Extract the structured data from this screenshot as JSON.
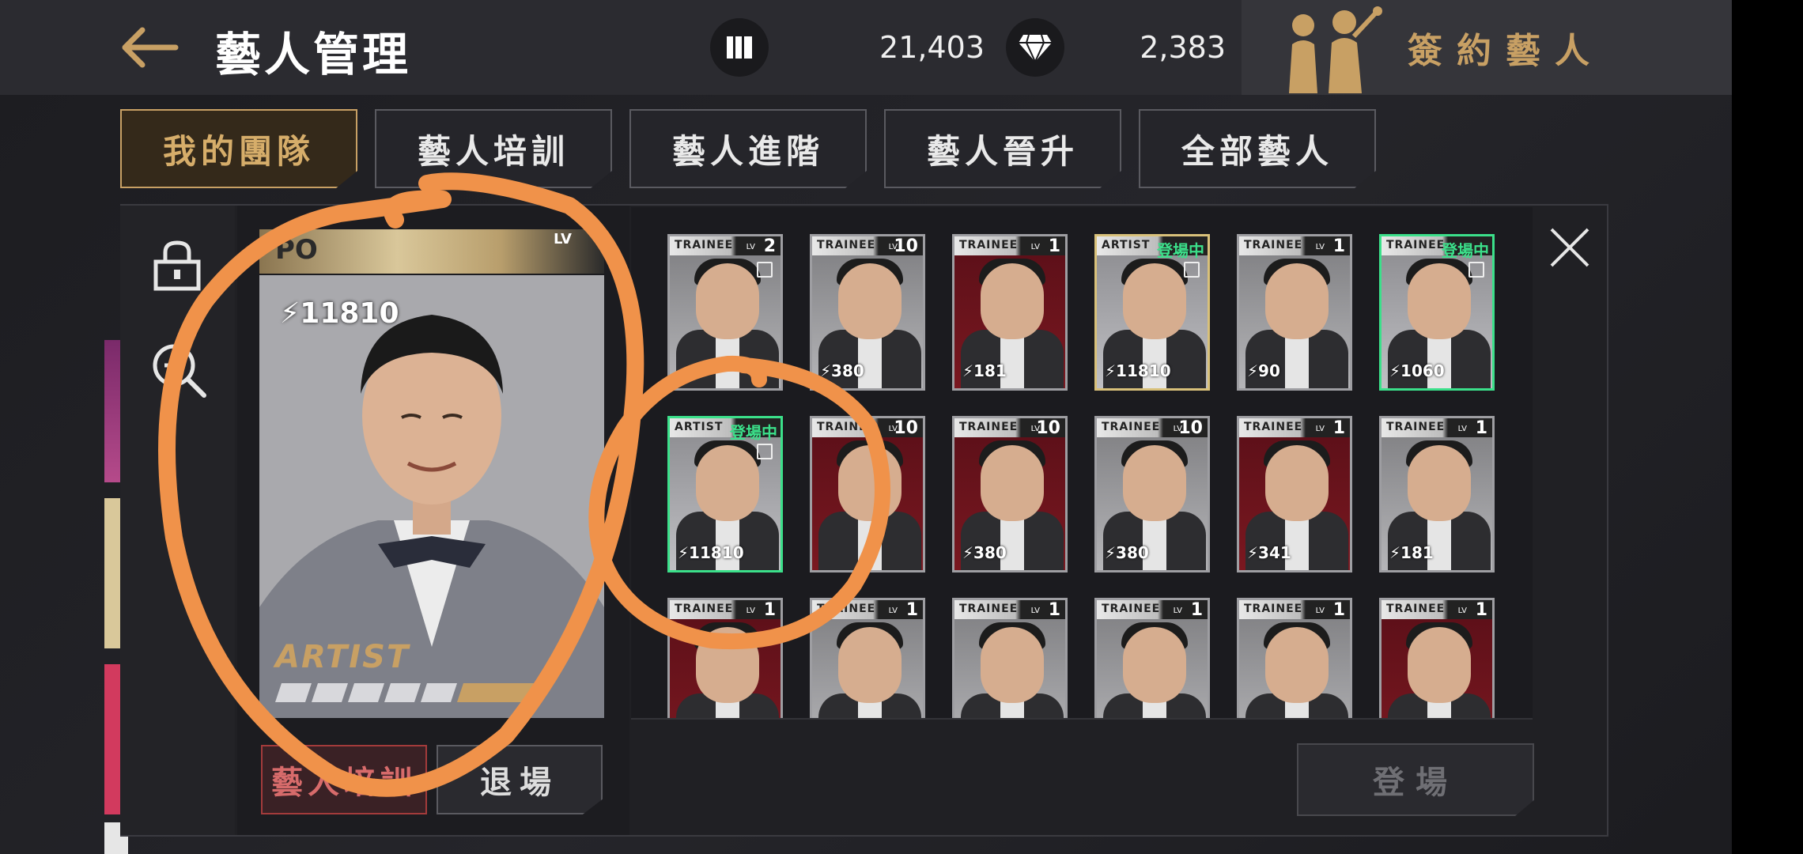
{
  "header": {
    "title": "藝人管理",
    "currency_1": "21,403",
    "currency_2": "2,383",
    "sign_label": "簽約藝人"
  },
  "tabs": [
    {
      "label": "我的團隊",
      "active": true
    },
    {
      "label": "藝人培訓",
      "active": false
    },
    {
      "label": "藝人進階",
      "active": false
    },
    {
      "label": "藝人晉升",
      "active": false
    },
    {
      "label": "全部藝人",
      "active": false
    }
  ],
  "selected_card": {
    "power": "11810",
    "top_strip_text": "PO",
    "lv_tag": "LV",
    "rank_logo_text": "ARTIST"
  },
  "buttons": {
    "train": "藝人培訓",
    "exit": "退場",
    "play": "登場"
  },
  "cards": [
    {
      "rank": "TRAINEE",
      "lv": "2",
      "power": "",
      "status": "",
      "style": "photo",
      "locked": true
    },
    {
      "rank": "TRAINEE",
      "lv": "10",
      "power": "380",
      "status": "",
      "style": "gray",
      "locked": false
    },
    {
      "rank": "TRAINEE",
      "lv": "1",
      "power": "181",
      "status": "",
      "style": "red",
      "locked": false
    },
    {
      "rank": "ARTIST",
      "lv": "",
      "power": "11810",
      "status": "登場中",
      "style": "gold",
      "locked": true
    },
    {
      "rank": "TRAINEE",
      "lv": "1",
      "power": "90",
      "status": "",
      "style": "gray",
      "locked": false
    },
    {
      "rank": "TRAINEE",
      "lv": "",
      "power": "1060",
      "status": "登場中",
      "style": "green",
      "locked": true
    },
    {
      "rank": "ARTIST",
      "lv": "",
      "power": "11810",
      "status": "登場中",
      "style": "green",
      "locked": true
    },
    {
      "rank": "TRAINEE",
      "lv": "10",
      "power": "",
      "status": "",
      "style": "red",
      "locked": false
    },
    {
      "rank": "TRAINEE",
      "lv": "10",
      "power": "380",
      "status": "",
      "style": "red",
      "locked": false
    },
    {
      "rank": "TRAINEE",
      "lv": "10",
      "power": "380",
      "status": "",
      "style": "gray",
      "locked": false
    },
    {
      "rank": "TRAINEE",
      "lv": "1",
      "power": "341",
      "status": "",
      "style": "red",
      "locked": false
    },
    {
      "rank": "TRAINEE",
      "lv": "1",
      "power": "181",
      "status": "",
      "style": "gray",
      "locked": false
    },
    {
      "rank": "TRAINEE",
      "lv": "1",
      "power": "",
      "status": "",
      "style": "red",
      "locked": false
    },
    {
      "rank": "TRAINEE",
      "lv": "1",
      "power": "",
      "status": "",
      "style": "gray",
      "locked": false
    },
    {
      "rank": "TRAINEE",
      "lv": "1",
      "power": "",
      "status": "",
      "style": "gray",
      "locked": false
    },
    {
      "rank": "TRAINEE",
      "lv": "1",
      "power": "",
      "status": "",
      "style": "gray",
      "locked": false
    },
    {
      "rank": "TRAINEE",
      "lv": "1",
      "power": "",
      "status": "",
      "style": "gray",
      "locked": false
    },
    {
      "rank": "TRAINEE",
      "lv": "1",
      "power": "",
      "status": "",
      "style": "red",
      "locked": false
    }
  ],
  "colors": {
    "accent_gold": "#c8a064",
    "onstage_green": "#3be08a",
    "annotation_orange": "#f0924a"
  }
}
